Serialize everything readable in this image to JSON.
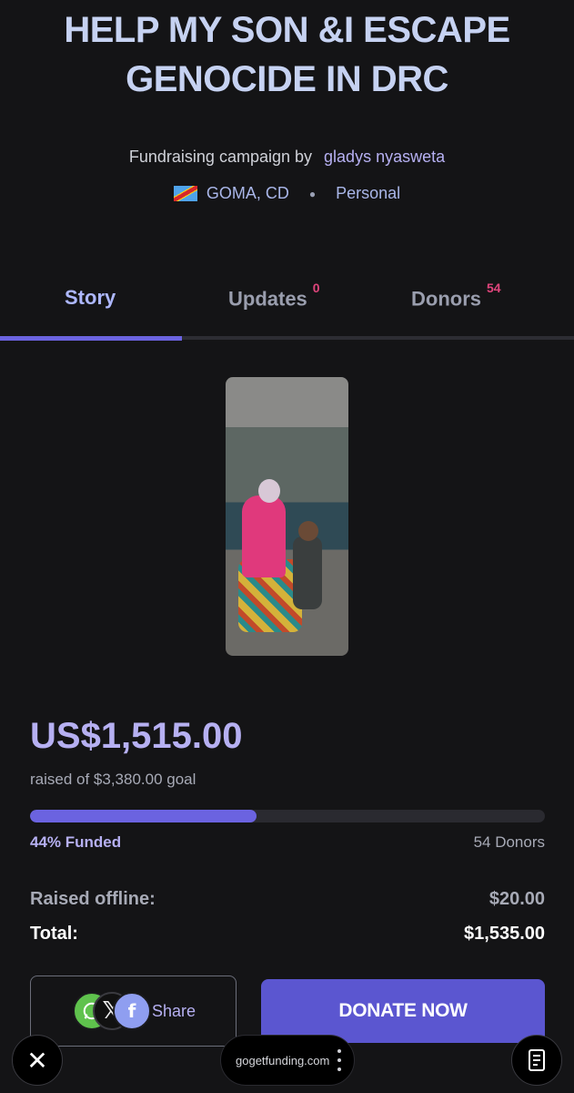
{
  "campaign": {
    "title_line1": "HELP MY SON &I ESCAPE",
    "title_line2": "GENOCIDE IN DRC",
    "byline_prefix": "Fundraising campaign by",
    "author": "gladys nyasweta",
    "location": "GOMA, CD",
    "category": "Personal",
    "flag_icon": "drc-flag-icon"
  },
  "tabs": [
    {
      "label": "Story",
      "count": ""
    },
    {
      "label": "Updates",
      "count": "0"
    },
    {
      "label": "Donors",
      "count": "54"
    }
  ],
  "funding": {
    "raised": "US$1,515.00",
    "goal_text": "raised of $3,380.00 goal",
    "progress_fraction": 0.44,
    "funded_label": "44% Funded",
    "donors_label": "54 Donors",
    "offline_label": "Raised offline:",
    "offline_value": "$20.00",
    "total_label": "Total:",
    "total_value": "$1,535.00"
  },
  "actions": {
    "share_label": "Share",
    "donate_label": "DONATE NOW"
  },
  "browser": {
    "url": "gogetfunding.com"
  },
  "colors": {
    "accent": "#6b63e0",
    "accent_text": "#b6b0f2",
    "badge": "#e0457c",
    "background": "#141416"
  }
}
